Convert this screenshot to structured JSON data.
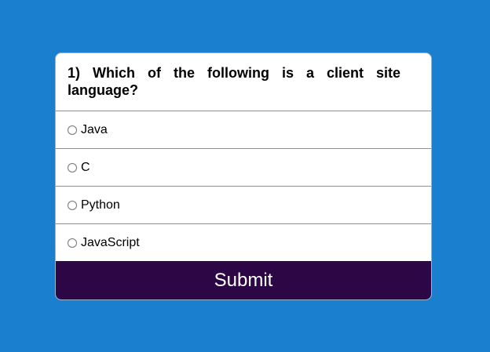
{
  "quiz": {
    "question": "1) Which of the following is a client site language?",
    "options": [
      {
        "label": "Java",
        "selected": false
      },
      {
        "label": "C",
        "selected": false
      },
      {
        "label": "Python",
        "selected": false
      },
      {
        "label": "JavaScript",
        "selected": false
      }
    ],
    "submit_label": "Submit"
  },
  "colors": {
    "background": "#1a7fcf",
    "card": "#ffffff",
    "submit_bg": "#2d0745",
    "submit_text": "#ffffff"
  }
}
